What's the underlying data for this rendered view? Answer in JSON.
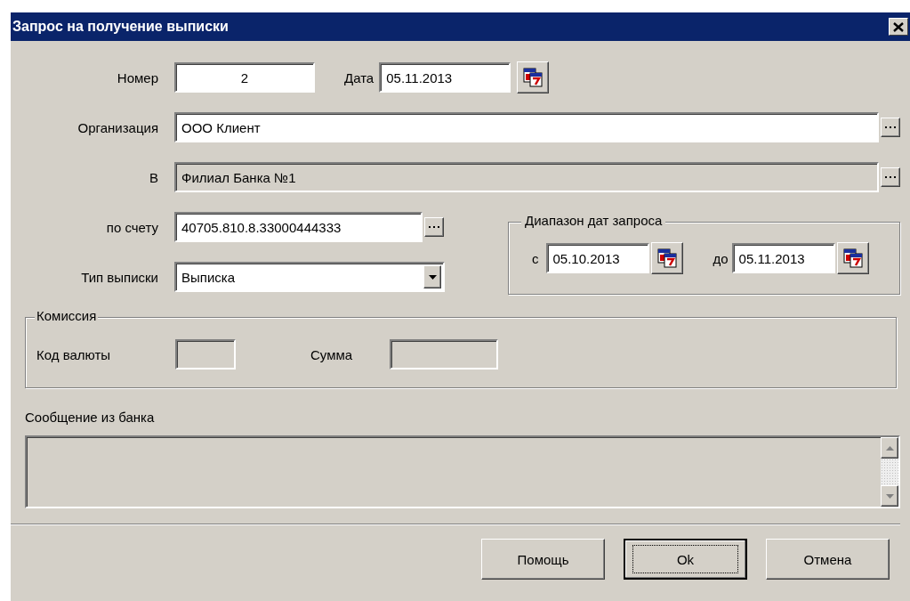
{
  "window": {
    "title": "Запрос на получение выписки"
  },
  "number": {
    "label": "Номер",
    "value": "2"
  },
  "date": {
    "label": "Дата",
    "value": "05.11.2013"
  },
  "organization": {
    "label": "Организация",
    "value": "ООО Клиент",
    "disabled": false
  },
  "bank": {
    "label": "В",
    "value": "Филиал Банка №1",
    "disabled": true
  },
  "account": {
    "label": "по счету",
    "value": "40705.810.8.33000444333"
  },
  "statement_type": {
    "label": "Тип выписки",
    "value": "Выписка"
  },
  "date_range": {
    "title": "Диапазон дат запроса",
    "from_label": "с",
    "from": "05.10.2013",
    "to_label": "до",
    "to": "05.11.2013"
  },
  "commission": {
    "title": "Комиссия",
    "currency_label": "Код валюты",
    "amount_label": "Сумма"
  },
  "message": {
    "label": "Сообщение из банка"
  },
  "buttons": [
    {
      "label": "Помощь",
      "default": false
    },
    {
      "label": "Ok",
      "default": true
    },
    {
      "label": "Отмена",
      "default": false
    }
  ]
}
